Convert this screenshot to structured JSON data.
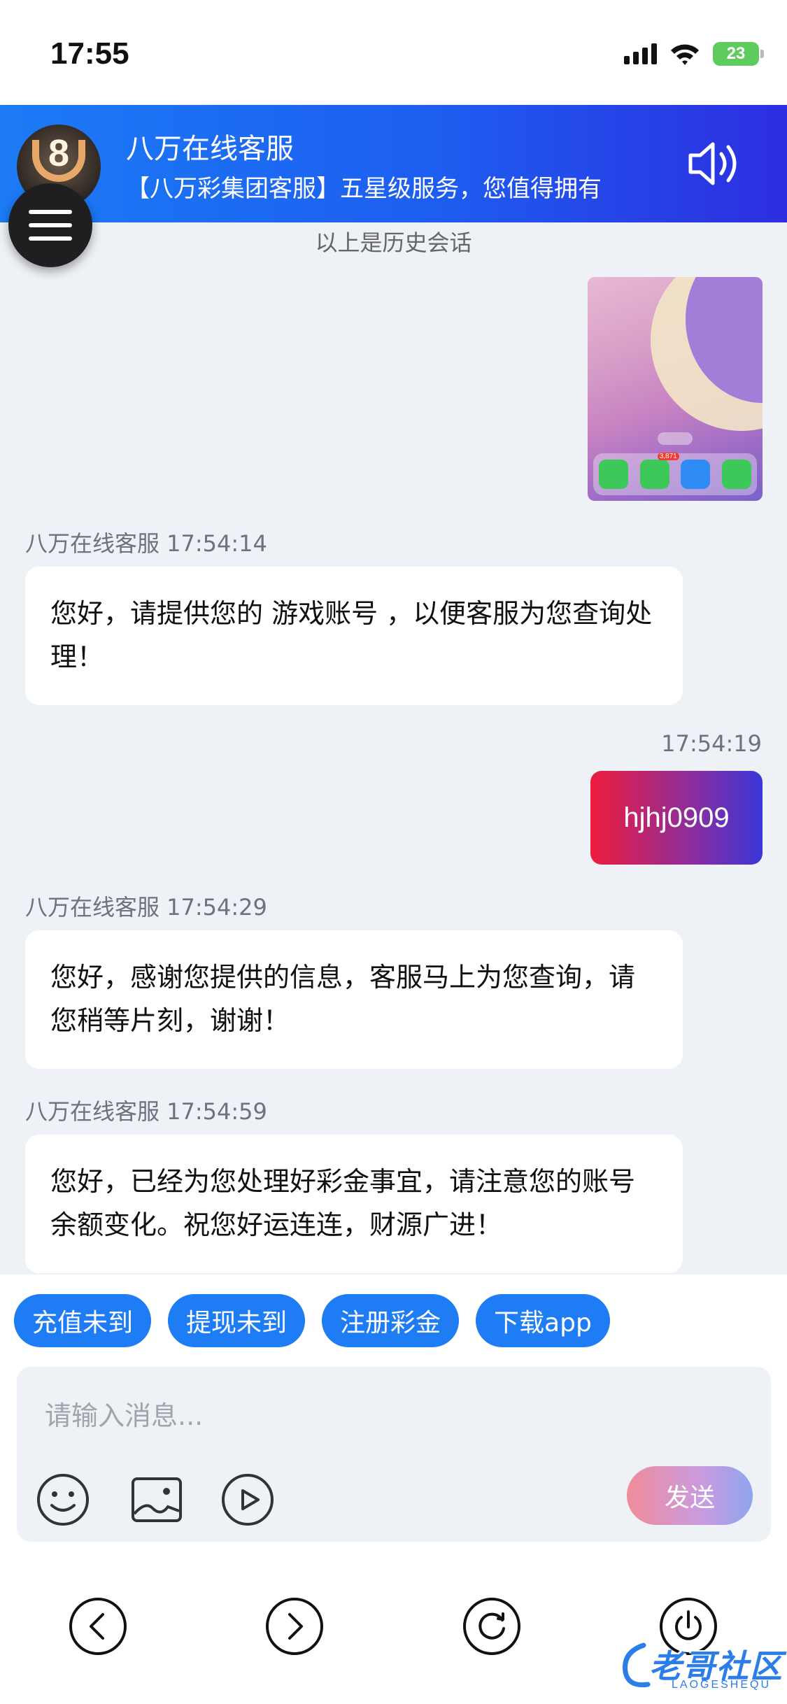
{
  "status_bar": {
    "time": "17:55",
    "battery": "23"
  },
  "header": {
    "title": "八万在线客服",
    "subtitle": "【八万彩集团客服】五星级服务，您值得拥有",
    "logo_text": "8",
    "accent_gradient": [
      "#1c7bf5",
      "#2d2ee0"
    ]
  },
  "chat": {
    "history_note": "以上是历史会话",
    "image_badge": "3,871",
    "messages": [
      {
        "meta": "八万在线客服 17:54:14",
        "text": "您好，请提供您的 游戏账号 ，以便客服为您查询处理！"
      },
      {
        "meta": "17:54:19",
        "text": "hjhj0909"
      },
      {
        "meta": "八万在线客服 17:54:29",
        "text": "您好，感谢您提供的信息，客服马上为您查询，请您稍等片刻，谢谢！"
      },
      {
        "meta": "八万在线客服 17:54:59",
        "text": "您好，已经为您处理好彩金事宜，请注意您的账号余额变化。祝您好运连连，财源广进！"
      }
    ]
  },
  "quick_replies": [
    "充值未到",
    "提现未到",
    "注册彩金",
    "下载app"
  ],
  "input": {
    "placeholder": "请输入消息...",
    "send_label": "发送"
  },
  "icons": {
    "emoji": "smile-icon",
    "image": "image-icon",
    "video": "play-icon",
    "speaker": "speaker-icon",
    "back": "chevron-left-icon",
    "forward": "chevron-right-icon",
    "refresh": "refresh-icon",
    "power": "power-icon"
  },
  "watermark": {
    "text": "老哥社区",
    "sub": "LAOGESHEQU"
  },
  "colors": {
    "quick_chip": "#1e7cf4",
    "user_bubble_start": "#ee1c3c",
    "user_bubble_end": "#3a36d8"
  }
}
